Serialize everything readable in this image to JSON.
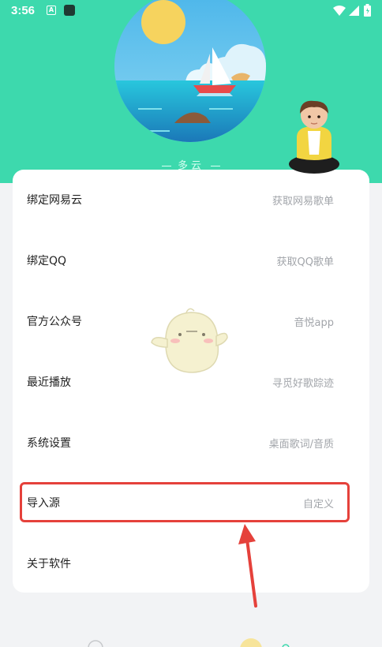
{
  "status_bar": {
    "time": "3:56",
    "a_badge": "A"
  },
  "weather": {
    "condition": "多云"
  },
  "menu": {
    "items": [
      {
        "label": "绑定网易云",
        "value": "获取网易歌单"
      },
      {
        "label": "绑定QQ",
        "value": "获取QQ歌单"
      },
      {
        "label": "官方公众号",
        "value": "音悦app"
      },
      {
        "label": "最近播放",
        "value": "寻觅好歌踪迹"
      },
      {
        "label": "系统设置",
        "value": "桌面歌词/音质"
      },
      {
        "label": "导入源",
        "value": "自定义"
      },
      {
        "label": "关于软件",
        "value": ""
      }
    ]
  },
  "colors": {
    "header": "#3dd9ad",
    "highlight": "#e5413b",
    "background": "#f2f3f5"
  },
  "icons": [
    "wifi-icon",
    "signal-icon",
    "battery-icon",
    "sun-icon",
    "sailboat-icon"
  ]
}
